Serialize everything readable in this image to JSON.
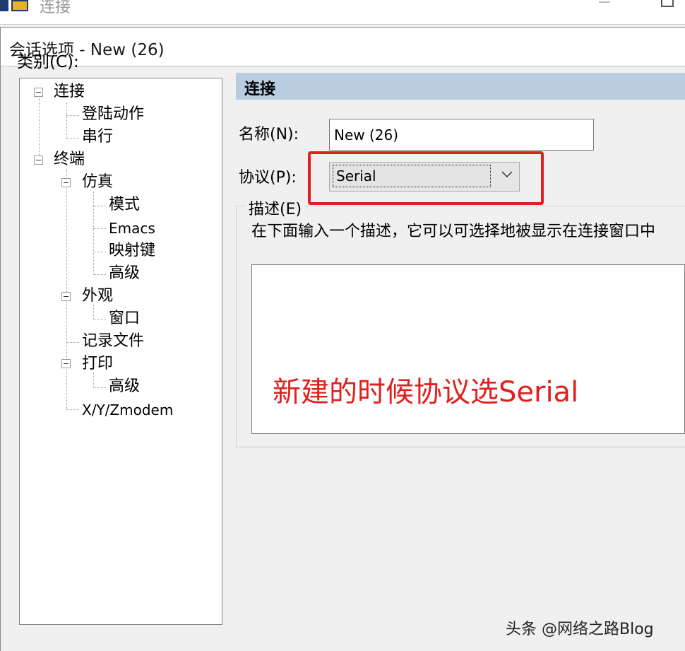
{
  "outer_window": {
    "title": "连接",
    "icon": "securecrt-app-icon"
  },
  "dialog": {
    "title": "会话选项 - New (26)"
  },
  "category": {
    "label": "类别(C):",
    "tree": [
      {
        "label": "连接",
        "depth": 0,
        "expanded": true,
        "selected": true
      },
      {
        "label": "登陆动作",
        "depth": 1
      },
      {
        "label": "串行",
        "depth": 1
      },
      {
        "label": "终端",
        "depth": 0,
        "expanded": true
      },
      {
        "label": "仿真",
        "depth": 1,
        "expanded": true
      },
      {
        "label": "模式",
        "depth": 2
      },
      {
        "label": "Emacs",
        "depth": 2
      },
      {
        "label": "映射键",
        "depth": 2
      },
      {
        "label": "高级",
        "depth": 2
      },
      {
        "label": "外观",
        "depth": 1,
        "expanded": true
      },
      {
        "label": "窗口",
        "depth": 2
      },
      {
        "label": "记录文件",
        "depth": 1
      },
      {
        "label": "打印",
        "depth": 1,
        "expanded": true
      },
      {
        "label": "高级",
        "depth": 2
      },
      {
        "label": "X/Y/Zmodem",
        "depth": 1
      }
    ]
  },
  "panel": {
    "header": "连接",
    "name_label": "名称(N):",
    "name_value": "New (26)",
    "protocol_label": "协议(P):",
    "protocol_value": "Serial",
    "description_legend": "描述(E)",
    "description_hint": "在下面输入一个描述，它可以可选择地被显示在连接窗口中",
    "description_value": ""
  },
  "annotation": {
    "text": "新建的时候协议选Serial",
    "color": "#e0201e"
  },
  "watermark": "头条 @网络之路Blog",
  "colors": {
    "header_bg": "#b9cce0",
    "highlight": "#e0201e",
    "dialog_bg": "#f0f0f0"
  }
}
